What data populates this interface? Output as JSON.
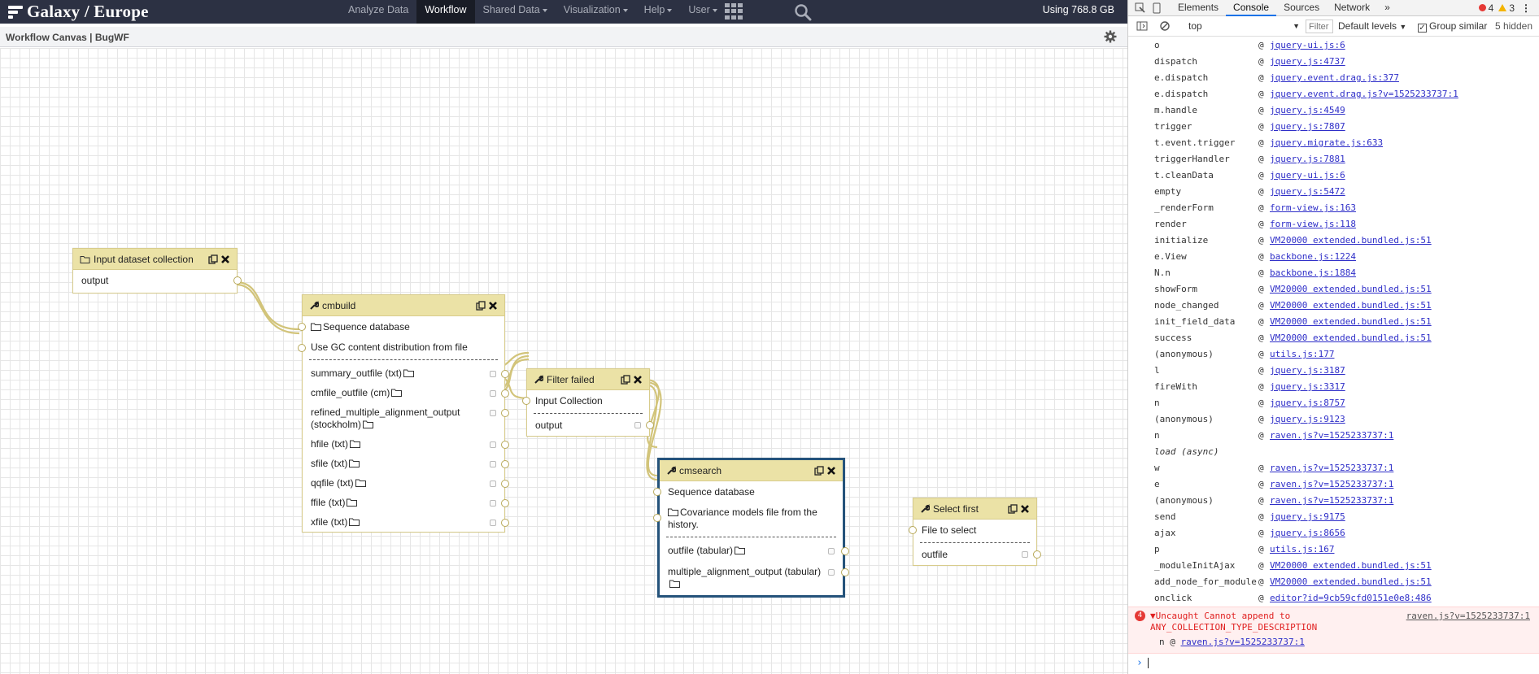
{
  "masthead": {
    "brand": "Galaxy / Europe",
    "tabs": [
      {
        "label": "Analyze Data",
        "dropdown": false,
        "active": false
      },
      {
        "label": "Workflow",
        "dropdown": false,
        "active": true
      },
      {
        "label": "Shared Data",
        "dropdown": true,
        "active": false
      },
      {
        "label": "Visualization",
        "dropdown": true,
        "active": false
      },
      {
        "label": "Help",
        "dropdown": true,
        "active": false
      },
      {
        "label": "User",
        "dropdown": true,
        "active": false
      }
    ],
    "quota": "Using 768.8 GB"
  },
  "canvas_header": {
    "title": "Workflow Canvas | BugWF"
  },
  "nodes": {
    "input_collection": {
      "title": "Input dataset collection",
      "outputs": [
        "output"
      ]
    },
    "cmbuild": {
      "title": "cmbuild",
      "inputs": [
        "Sequence database",
        "Use GC content distribution from file"
      ],
      "outputs": [
        "summary_outfile (txt)",
        "cmfile_outfile (cm)",
        "refined_multiple_alignment_output (stockholm)",
        "hfile (txt)",
        "sfile (txt)",
        "qqfile (txt)",
        "ffile (txt)",
        "xfile (txt)"
      ]
    },
    "filter_failed": {
      "title": "Filter failed",
      "inputs": [
        "Input Collection"
      ],
      "outputs": [
        "output"
      ]
    },
    "cmsearch": {
      "title": "cmsearch",
      "inputs": [
        "Sequence database",
        "Covariance models file from the history."
      ],
      "outputs": [
        "outfile (tabular)",
        "multiple_alignment_output (tabular)"
      ]
    },
    "select_first": {
      "title": "Select first",
      "inputs": [
        "File to select"
      ],
      "outputs": [
        "outfile"
      ]
    }
  },
  "devtools": {
    "tabs": [
      "Elements",
      "Console",
      "Sources",
      "Network",
      "»"
    ],
    "active_tab": "Console",
    "error_count": "4",
    "warning_count": "3",
    "context": "top",
    "filter_placeholder": "Filter",
    "levels": "Default levels",
    "group_similar": "Group similar",
    "hidden": "5 hidden",
    "stack": [
      {
        "fn": "o",
        "src": "jquery-ui.js:6"
      },
      {
        "fn": "dispatch",
        "src": "jquery.js:4737"
      },
      {
        "fn": "e.dispatch",
        "src": "jquery.event.drag.js:377"
      },
      {
        "fn": "e.dispatch",
        "src": "jquery.event.drag.js?v=1525233737:1"
      },
      {
        "fn": "m.handle",
        "src": "jquery.js:4549"
      },
      {
        "fn": "trigger",
        "src": "jquery.js:7807"
      },
      {
        "fn": "t.event.trigger",
        "src": "jquery.migrate.js:633"
      },
      {
        "fn": "triggerHandler",
        "src": "jquery.js:7881"
      },
      {
        "fn": "t.cleanData",
        "src": "jquery-ui.js:6"
      },
      {
        "fn": "empty",
        "src": "jquery.js:5472"
      },
      {
        "fn": "_renderForm",
        "src": "form-view.js:163"
      },
      {
        "fn": "render",
        "src": "form-view.js:118"
      },
      {
        "fn": "initialize",
        "src": "VM20000 extended.bundled.js:51"
      },
      {
        "fn": "e.View",
        "src": "backbone.js:1224"
      },
      {
        "fn": "N.n",
        "src": "backbone.js:1884"
      },
      {
        "fn": "showForm",
        "src": "VM20000 extended.bundled.js:51"
      },
      {
        "fn": "node_changed",
        "src": "VM20000 extended.bundled.js:51"
      },
      {
        "fn": "init_field_data",
        "src": "VM20000 extended.bundled.js:51"
      },
      {
        "fn": "success",
        "src": "VM20000 extended.bundled.js:51"
      },
      {
        "fn": "(anonymous)",
        "src": "utils.js:177"
      },
      {
        "fn": "l",
        "src": "jquery.js:3187"
      },
      {
        "fn": "fireWith",
        "src": "jquery.js:3317"
      },
      {
        "fn": "n",
        "src": "jquery.js:8757"
      },
      {
        "fn": "(anonymous)",
        "src": "jquery.js:9123"
      },
      {
        "fn": "n",
        "src": "raven.js?v=1525233737:1"
      },
      {
        "fn": "load (async)",
        "src": "",
        "async": true
      },
      {
        "fn": "w",
        "src": "raven.js?v=1525233737:1"
      },
      {
        "fn": "e",
        "src": "raven.js?v=1525233737:1"
      },
      {
        "fn": "(anonymous)",
        "src": "raven.js?v=1525233737:1"
      },
      {
        "fn": "send",
        "src": "jquery.js:9175"
      },
      {
        "fn": "ajax",
        "src": "jquery.js:8656"
      },
      {
        "fn": "p",
        "src": "utils.js:167"
      },
      {
        "fn": "_moduleInitAjax",
        "src": "VM20000 extended.bundled.js:51"
      },
      {
        "fn": "add_node_for_module",
        "src": "VM20000 extended.bundled.js:51"
      },
      {
        "fn": "onclick",
        "src": "editor?id=9cb59cfd0151e0e8:486"
      }
    ],
    "error": {
      "count": "4",
      "message_line1": "Uncaught Cannot append to",
      "message_line2": "ANY_COLLECTION_TYPE_DESCRIPTION",
      "source": "raven.js?v=1525233737:1",
      "frame_fn": "n",
      "frame_src": "raven.js?v=1525233737:1"
    }
  }
}
